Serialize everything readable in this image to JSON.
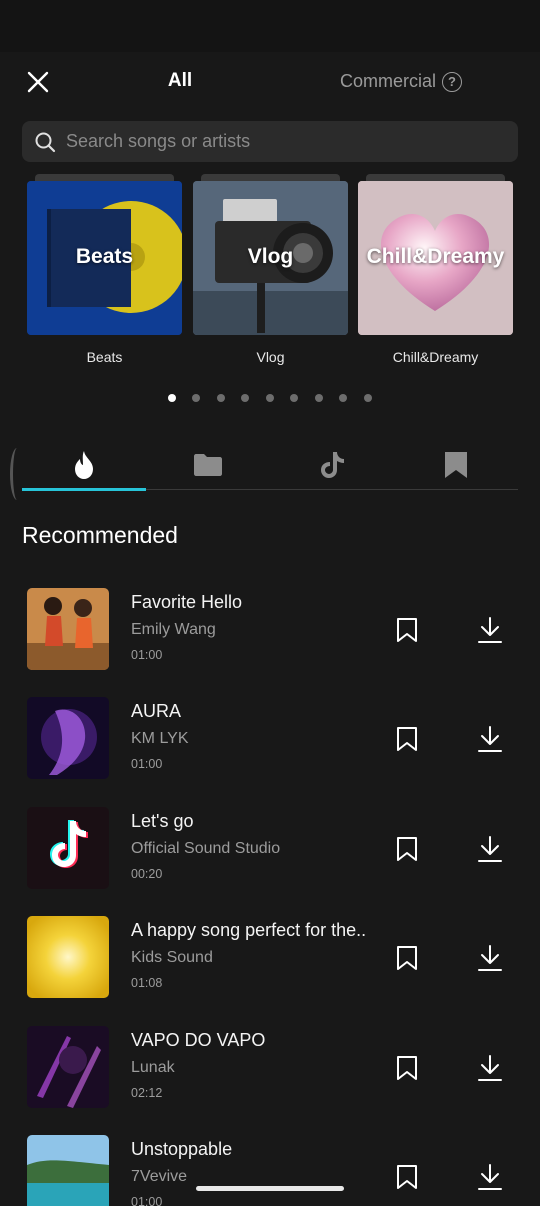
{
  "header": {
    "tab_all": "All",
    "tab_commercial": "Commercial",
    "help_glyph": "?"
  },
  "search": {
    "placeholder": "Search songs or artists"
  },
  "categories": [
    {
      "title": "Beats",
      "label": "Beats"
    },
    {
      "title": "Vlog",
      "label": "Vlog"
    },
    {
      "title": "Chill&Dreamy",
      "label": "Chill&Dreamy"
    }
  ],
  "carousel": {
    "page_count": 9,
    "active_page": 1
  },
  "tabs": {
    "items": [
      "fire-icon",
      "folder-icon",
      "tiktok-icon",
      "bookmark-icon"
    ],
    "active": "fire-icon",
    "accent_color": "#27c4d8"
  },
  "section": {
    "title": "Recommended"
  },
  "songs": [
    {
      "title": "Favorite Hello",
      "artist": "Emily Wang",
      "duration": "01:00"
    },
    {
      "title": "AURA",
      "artist": "KM LYK",
      "duration": "01:00"
    },
    {
      "title": "Let's go",
      "artist": "Official Sound Studio",
      "duration": "00:20"
    },
    {
      "title": "A happy song perfect for the..",
      "artist": "Kids Sound",
      "duration": "01:08"
    },
    {
      "title": "VAPO DO VAPO",
      "artist": "Lunak",
      "duration": "02:12"
    },
    {
      "title": "Unstoppable",
      "artist": "7Vevive",
      "duration": "01:00"
    }
  ]
}
